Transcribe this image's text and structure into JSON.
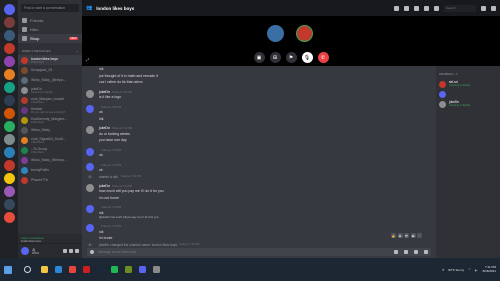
{
  "colors": {
    "accent": "#5865f2",
    "online": "#3ba55d",
    "danger": "#ed4245",
    "bg_chat": "#36393f",
    "bg_sidebar": "#2f3136"
  },
  "servers": [
    {
      "name": "home",
      "color": "#5865f2"
    },
    {
      "name": "s1",
      "color": "#7a3b3b"
    },
    {
      "name": "s2",
      "color": "#3b5a7a"
    },
    {
      "name": "s3",
      "color": "#c0392b"
    },
    {
      "name": "s4",
      "color": "#8e44ad"
    },
    {
      "name": "s5",
      "color": "#e67e22"
    },
    {
      "name": "s6",
      "color": "#16a085"
    },
    {
      "name": "s7",
      "color": "#2c3e50"
    },
    {
      "name": "s8",
      "color": "#d35400"
    },
    {
      "name": "s9",
      "color": "#27ae60"
    },
    {
      "name": "s10",
      "color": "#7f8c8d"
    },
    {
      "name": "s11",
      "color": "#2980b9"
    },
    {
      "name": "s12",
      "color": "#c0392b"
    },
    {
      "name": "s13",
      "color": "#f1c40f"
    },
    {
      "name": "s14",
      "color": "#9b59b6"
    },
    {
      "name": "s15",
      "color": "#34495e"
    },
    {
      "name": "s16",
      "color": "#e74c3c"
    }
  ],
  "dms_panel": {
    "search_placeholder": "Find or start a conversation",
    "nav": [
      {
        "label": "Friends"
      },
      {
        "label": "Nitro"
      },
      {
        "label": "Shop",
        "badge": "NEW"
      }
    ],
    "section_label": "DIRECT MESSAGES",
    "dms": [
      {
        "name": "london likes boys",
        "sub": "3 Members",
        "color": "#c0392b",
        "active": true
      },
      {
        "name": "Scrapjack_03",
        "sub": "",
        "color": "#7a4b2b"
      },
      {
        "name": "Wiwo_Nicky_@nhpo...",
        "sub": "",
        "color": "#5b6b7a"
      },
      {
        "name": "jokeDn",
        "sub": "Listening to Spotify",
        "color": "#8e8e8e"
      },
      {
        "name": "cool_Marqaro_lcaddr",
        "sub": "3 Members",
        "color": "#b03a2e"
      },
      {
        "name": "Kredoe",
        "sub": "Do you want to say anything?",
        "color": "#6c3483"
      },
      {
        "name": "Kooblemoty_Margare...",
        "sub": "3 Members",
        "color": "#b7950b"
      },
      {
        "name": "Wiwo_Nicky",
        "sub": "",
        "color": "#555"
      },
      {
        "name": "cool_Signal04_Kooll...",
        "sub": "3 Members",
        "color": "#e67e22"
      },
      {
        "name": "..7s Group",
        "sub": "3 Members",
        "color": "#1e8449"
      },
      {
        "name": "Wiwo_Nicky_Winhop...",
        "sub": "",
        "color": "#7d3c98"
      },
      {
        "name": "bnndyFallin",
        "sub": "",
        "color": "#2e86c1"
      },
      {
        "name": "Phazer77b",
        "sub": "",
        "color": "#c0392b"
      }
    ]
  },
  "voice": {
    "status": "Voice Connected",
    "channel": "london likes boys"
  },
  "user": {
    "name": "Jj",
    "tag": "#0001"
  },
  "topbar": {
    "channel": "london likes boys",
    "search_placeholder": "Search"
  },
  "messages": [
    {
      "type": "cont",
      "text": "idk"
    },
    {
      "type": "cont",
      "text": "joe thought of it in math and remade it"
    },
    {
      "type": "cont",
      "text": "cuz i rather do tis than alexx"
    },
    {
      "type": "head",
      "author": "jokeDn",
      "time": "Today at 7:09 PM",
      "text": "is it like a logo",
      "color": "#8e8e8e"
    },
    {
      "type": "head",
      "author": "",
      "time": "Today at 7:09 PM",
      "text": "ok",
      "color": "#5865f2"
    },
    {
      "type": "cont",
      "text": "idk"
    },
    {
      "type": "head",
      "author": "jokeDn",
      "time": "Today at 7:10 PM",
      "text": "do ur fucking weeks",
      "color": "#8e8e8e"
    },
    {
      "type": "cont",
      "text": "you have one day"
    },
    {
      "type": "head",
      "author": "",
      "time": "Today at 7:10 PM",
      "text": "ok",
      "color": "#5865f2"
    },
    {
      "type": "head",
      "author": "",
      "time": "Today at 7:10 PM",
      "text": "ok",
      "color": "#5865f2"
    },
    {
      "type": "sys",
      "text": "started a call.",
      "time": "Today at 7:10 PM"
    },
    {
      "type": "head",
      "author": "jokeDn",
      "time": "Today at 7:10 PM",
      "text": "how much will you pay me if i do it for you",
      "color": "#8e8e8e"
    },
    {
      "type": "cont",
      "text": "i'm not home"
    },
    {
      "type": "head",
      "author": "",
      "time": "Today at 7:10 PM",
      "text": "idk",
      "color": "#5865f2"
    },
    {
      "type": "reply",
      "reply": "@jokeDn how much will you pay me if i do it for you"
    },
    {
      "type": "head",
      "author": "",
      "time": "Today at 7:10 PM",
      "text": "idk",
      "color": "#5865f2"
    },
    {
      "type": "cont",
      "text": "im broke"
    },
    {
      "type": "sys",
      "text": "jokeDn changed the channel name: london likes boys",
      "time": "Today at 7:10 PM"
    }
  ],
  "reactions": [
    "👍",
    "😆",
    "😳",
    "😂",
    "➕"
  ],
  "composer": {
    "placeholder": "Message london likes boys"
  },
  "members": {
    "header": "MEMBERS—3",
    "list": [
      {
        "name": "sirLsd",
        "sub": "Listening to Spotify",
        "color": "#c0392b"
      },
      {
        "name": "",
        "sub": "",
        "color": "#5865f2"
      },
      {
        "name": "jokeDn",
        "sub": "Listening to Spotify",
        "color": "#8e8e8e"
      }
    ]
  },
  "taskbar": {
    "apps": [
      {
        "name": "explorer",
        "color": "#f4c542"
      },
      {
        "name": "edge",
        "color": "#2b88d8"
      },
      {
        "name": "chrome",
        "color": "#e8453c"
      },
      {
        "name": "opera",
        "color": "#cc1f1f"
      },
      {
        "name": "steam",
        "color": "#1b2838"
      },
      {
        "name": "spotify",
        "color": "#1db954"
      },
      {
        "name": "minecraft",
        "color": "#6b8e23"
      },
      {
        "name": "discord",
        "color": "#5865f2"
      },
      {
        "name": "photos",
        "color": "#8a8a8a"
      }
    ],
    "weather": "82°F Sunny",
    "time": "7:11 PM",
    "date": "8/18/2021"
  }
}
